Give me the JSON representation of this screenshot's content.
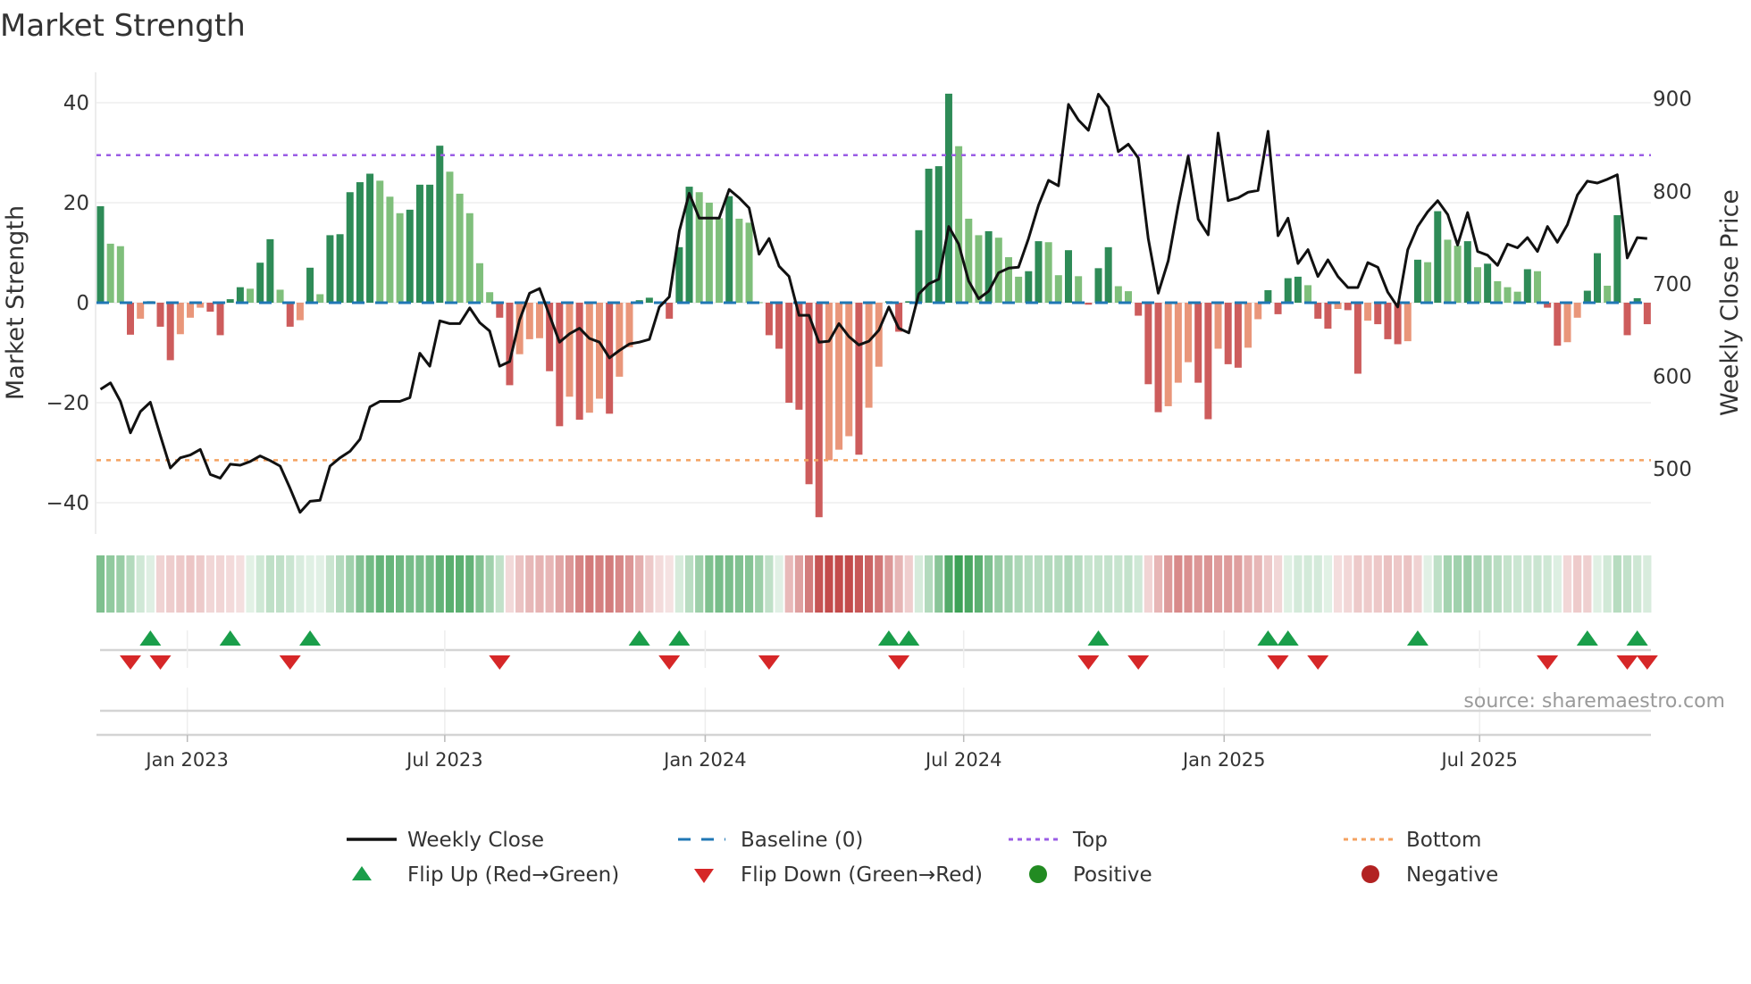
{
  "chart_data": {
    "type": "bar",
    "title": "Market Strength",
    "ylabel": "Market Strength",
    "y2label": "Weekly Close Price",
    "ylim": [
      -46,
      46
    ],
    "y2lim": [
      435,
      935
    ],
    "yticks": [
      40,
      20,
      0,
      -20,
      -40
    ],
    "y2ticks": [
      900,
      800,
      700,
      600,
      500
    ],
    "grid": true,
    "top_level": 29.5,
    "bottom_level": -31.5,
    "baseline": 0,
    "x_unit": "week index",
    "xticks": [
      {
        "week": 9.7,
        "label": "Jan 2023"
      },
      {
        "week": 35.5,
        "label": "Jul 2023"
      },
      {
        "week": 61.6,
        "label": "Jan 2024"
      },
      {
        "week": 87.5,
        "label": "Jul 2024"
      },
      {
        "week": 113.6,
        "label": "Jan 2025"
      },
      {
        "week": 139.2,
        "label": "Jul 2025"
      }
    ],
    "strength": [
      19.3,
      11.8,
      11.3,
      -6.4,
      -3.2,
      0.3,
      -4.8,
      -11.5,
      -6.3,
      -3,
      -1,
      -1.8,
      -6.5,
      0.7,
      3.1,
      2.8,
      8,
      12.7,
      2.6,
      -4.8,
      -3.5,
      7,
      1.7,
      13.5,
      13.7,
      22.1,
      24.1,
      25.8,
      24.4,
      21.2,
      17.9,
      18.6,
      23.6,
      23.6,
      31.4,
      26.2,
      21.8,
      17.9,
      7.9,
      2.1,
      -3,
      -16.5,
      -10.3,
      -7.3,
      -7.1,
      -13.7,
      -24.7,
      -18.8,
      -23.4,
      -22,
      -19.2,
      -22.2,
      -14.8,
      -8.9,
      0.5,
      1,
      0.2,
      -3.2,
      11.1,
      23.2,
      22.1,
      20,
      16.9,
      21.3,
      16.8,
      16,
      0.1,
      -6.5,
      -9.2,
      -20,
      -21.4,
      -36.3,
      -42.9,
      -31.5,
      -29.4,
      -26.7,
      -30.4,
      -21,
      -12.8,
      0.3,
      -5.8,
      0.3,
      14.5,
      26.8,
      27.3,
      41.8,
      31.3,
      16.8,
      13.5,
      14.3,
      13,
      9.1,
      5.2,
      6.3,
      12.3,
      12.1,
      5.5,
      10.5,
      5.3,
      -0.4,
      6.9,
      11.1,
      3.3,
      2.3,
      -2.6,
      -16.3,
      -21.9,
      -20.7,
      -16,
      -11.9,
      -16,
      -23.3,
      -9.2,
      -12.3,
      -13,
      -9,
      -3.3,
      2.5,
      -2.3,
      4.9,
      5.2,
      3.5,
      -3.2,
      -5.2,
      -1.25,
      -1.5,
      -14.2,
      -3.6,
      -4.3,
      -7.3,
      -8.3,
      -7.7,
      8.6,
      8.1,
      18.3,
      12.6,
      11.4,
      12.3,
      7.1,
      7.8,
      4.3,
      3.1,
      2.2,
      6.7,
      6.3,
      -1,
      -8.6,
      -7.9,
      -3,
      2.4,
      9.9,
      3.4,
      17.5,
      -6.5,
      0.9,
      -4.3
    ],
    "weekly_close": [
      586,
      593,
      573,
      539,
      562,
      572,
      536,
      501,
      512,
      515,
      521,
      494,
      490,
      505,
      504,
      508,
      514,
      509,
      503,
      479,
      453,
      465,
      466,
      503,
      512,
      519,
      532,
      567,
      573,
      573,
      573,
      577,
      625,
      611,
      660,
      657,
      657,
      674,
      658,
      649,
      611,
      616,
      661,
      690,
      695,
      666,
      637,
      646,
      652,
      641,
      637,
      620,
      628,
      635,
      637,
      640,
      675,
      686,
      757,
      798,
      771,
      771,
      771,
      802,
      793,
      782,
      732,
      749,
      719,
      708,
      666,
      666,
      637,
      638,
      657,
      643,
      634,
      638,
      650,
      675,
      652,
      647,
      689,
      700,
      705,
      762,
      743,
      703,
      684,
      692,
      712,
      717,
      718,
      749,
      785,
      812,
      806,
      894,
      877,
      866,
      905,
      891,
      843,
      851,
      836,
      749,
      690,
      725,
      785,
      838,
      770,
      753,
      863,
      790,
      793,
      799,
      801,
      865,
      752,
      771,
      722,
      737,
      708,
      726,
      708,
      696,
      696,
      723,
      718,
      691,
      675,
      737,
      762,
      778,
      790,
      775,
      742,
      777,
      735,
      731,
      720,
      743,
      739,
      750,
      735,
      762,
      745,
      764,
      796,
      811,
      809,
      813,
      818,
      728,
      750,
      749
    ],
    "flip_up_weeks": [
      6,
      14,
      22,
      55,
      59,
      80,
      82,
      101,
      118,
      120,
      133,
      150,
      155
    ],
    "flip_down_weeks": [
      4,
      7,
      20,
      41,
      58,
      68,
      81,
      100,
      105,
      119,
      123,
      146,
      154,
      156
    ],
    "colors": {
      "pos_strong": "#2e8b57",
      "pos_weak": "#7fbf7b",
      "neg_strong": "#cd5c5c",
      "neg_weak": "#e9967a",
      "price": "#111111",
      "baseline": "#1f77b4",
      "top": "#9b5de5",
      "bottom": "#f4a261",
      "flip_up": "#1a9e4a",
      "flip_down": "#d62728",
      "positive": "#228b22",
      "negative": "#b22222"
    },
    "legend": {
      "placement": "bottom",
      "items": [
        "Weekly Close",
        "Baseline (0)",
        "Top",
        "Bottom",
        "Flip Up (Red→Green)",
        "Flip Down (Green→Red)",
        "Positive",
        "Negative"
      ]
    },
    "source": "source: sharemaestro.com"
  }
}
